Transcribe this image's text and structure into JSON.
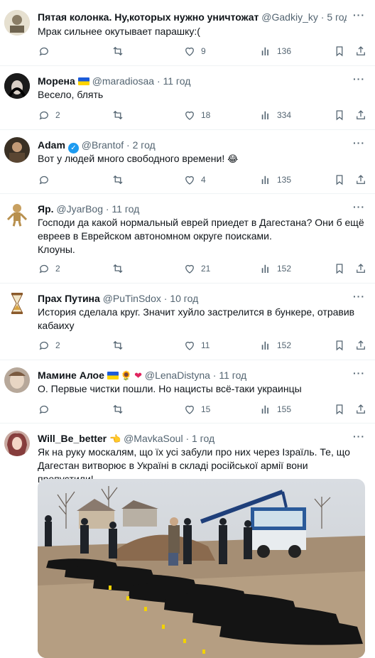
{
  "tweets": [
    {
      "name": "Пятая колонка. Ну,которых нужно уничтожат",
      "handle": "@Gadkiy_ky",
      "time": "· 5 год",
      "text": "Мрак сильнее окутывает парашку:(",
      "replies": "",
      "retweets": "",
      "likes": "9",
      "views": "136"
    },
    {
      "name": "Морена",
      "handle": "@maradiosaa",
      "time": "· 11 год",
      "text": "Весело, блять",
      "replies": "2",
      "retweets": "",
      "likes": "18",
      "views": "334"
    },
    {
      "name": "Adam",
      "handle": "@Brantof",
      "time": "· 2 год",
      "text": "Вот у людей много свободного времени!",
      "replies": "",
      "retweets": "",
      "likes": "4",
      "views": "135"
    },
    {
      "name": "Яр.",
      "handle": "@JyarBog",
      "time": "· 11 год",
      "text_lines": [
        "Господи да какой нормальный еврей приедет в Дагестана? Они б ещё",
        "евреев в Еврейском автономном округе поисками.",
        "Клоуны."
      ],
      "replies": "2",
      "retweets": "",
      "likes": "21",
      "views": "152"
    },
    {
      "name": "Прах Путина",
      "handle": "@PuTinSdox",
      "time": "· 10 год",
      "text_lines": [
        "История сделала круг. Значит хуйло застрелится в бункере, отравив",
        "кабаиху"
      ],
      "replies": "2",
      "retweets": "",
      "likes": "11",
      "views": "152"
    },
    {
      "name": "Мамине Алое",
      "handle": "@LenaDistyna",
      "time": "· 11 год",
      "text": "О. Первые чистки пошли. Но нацисты всё-таки украинцы",
      "replies": "",
      "retweets": "",
      "likes": "15",
      "views": "155"
    },
    {
      "name": "Will_Be_better",
      "handle": "@MavkaSoul",
      "time": "· 1 год",
      "text_lines": [
        "Як на руку москалям, що їх усі забули про них через Ізраїль. Те, що",
        "Дагестан витворює в Україні в складі російської армії вони пропустили!"
      ]
    }
  ],
  "icons": [
    "reply-icon",
    "retweet-icon",
    "like-icon",
    "views-icon",
    "bookmark-icon",
    "share-icon"
  ],
  "colors": {
    "text": "#0f1419",
    "secondary": "#536471",
    "verified": "#1d9bf0",
    "divider": "#eff3f4"
  }
}
